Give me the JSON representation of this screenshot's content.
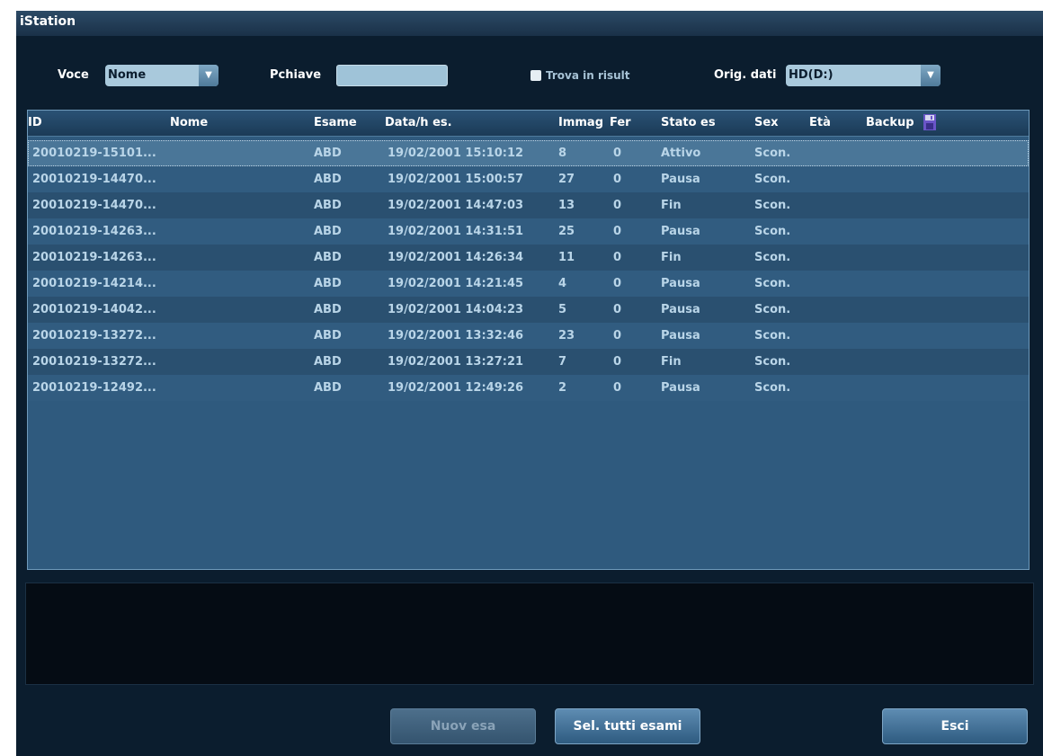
{
  "window": {
    "title": "iStation"
  },
  "search": {
    "voce_label": "Voce",
    "voce_value": "Nome",
    "pchiave_label": "Pchiave",
    "pchiave_value": "",
    "trova_label": "Trova in risult",
    "orig_label": "Orig. dati",
    "orig_value": "HD(D:)"
  },
  "table": {
    "headers": {
      "id": "ID",
      "nome": "Nome",
      "esame": "Esame",
      "data": "Data/h es.",
      "immag": "Immag",
      "fer": "Fer",
      "stato": "Stato es",
      "sex": "Sex",
      "eta": "Età",
      "backup": "Backup"
    },
    "rows": [
      {
        "id": "20010219-15101...",
        "nome": "",
        "esame": "ABD",
        "data": "19/02/2001 15:10:12",
        "immag": "8",
        "fer": "0",
        "stato": "Attivo",
        "sex": "Scon.",
        "eta": "",
        "backup": ""
      },
      {
        "id": "20010219-14470...",
        "nome": "",
        "esame": "ABD",
        "data": "19/02/2001 15:00:57",
        "immag": "27",
        "fer": "0",
        "stato": "Pausa",
        "sex": "Scon.",
        "eta": "",
        "backup": ""
      },
      {
        "id": "20010219-14470...",
        "nome": "",
        "esame": "ABD",
        "data": "19/02/2001 14:47:03",
        "immag": "13",
        "fer": "0",
        "stato": "Fin",
        "sex": "Scon.",
        "eta": "",
        "backup": ""
      },
      {
        "id": "20010219-14263...",
        "nome": "",
        "esame": "ABD",
        "data": "19/02/2001 14:31:51",
        "immag": "25",
        "fer": "0",
        "stato": "Pausa",
        "sex": "Scon.",
        "eta": "",
        "backup": ""
      },
      {
        "id": "20010219-14263...",
        "nome": "",
        "esame": "ABD",
        "data": "19/02/2001 14:26:34",
        "immag": "11",
        "fer": "0",
        "stato": "Fin",
        "sex": "Scon.",
        "eta": "",
        "backup": ""
      },
      {
        "id": "20010219-14214...",
        "nome": "",
        "esame": "ABD",
        "data": "19/02/2001 14:21:45",
        "immag": "4",
        "fer": "0",
        "stato": "Pausa",
        "sex": "Scon.",
        "eta": "",
        "backup": ""
      },
      {
        "id": "20010219-14042...",
        "nome": "",
        "esame": "ABD",
        "data": "19/02/2001 14:04:23",
        "immag": "5",
        "fer": "0",
        "stato": "Pausa",
        "sex": "Scon.",
        "eta": "",
        "backup": ""
      },
      {
        "id": "20010219-13272...",
        "nome": "",
        "esame": "ABD",
        "data": "19/02/2001 13:32:46",
        "immag": "23",
        "fer": "0",
        "stato": "Pausa",
        "sex": "Scon.",
        "eta": "",
        "backup": ""
      },
      {
        "id": "20010219-13272...",
        "nome": "",
        "esame": "ABD",
        "data": "19/02/2001 13:27:21",
        "immag": "7",
        "fer": "0",
        "stato": "Fin",
        "sex": "Scon.",
        "eta": "",
        "backup": ""
      },
      {
        "id": "20010219-12492...",
        "nome": "",
        "esame": "ABD",
        "data": "19/02/2001 12:49:26",
        "immag": "2",
        "fer": "0",
        "stato": "Pausa",
        "sex": "Scon.",
        "eta": "",
        "backup": ""
      }
    ],
    "selected_row": 0
  },
  "buttons": {
    "nuov_esa": "Nuov esa",
    "sel_tutti": "Sel. tutti esami",
    "esci": "Esci"
  },
  "icons": {
    "voce_arrow": "chevron-down-icon",
    "orig_arrow": "chevron-down-icon",
    "backup": "floppy-disk-icon"
  }
}
